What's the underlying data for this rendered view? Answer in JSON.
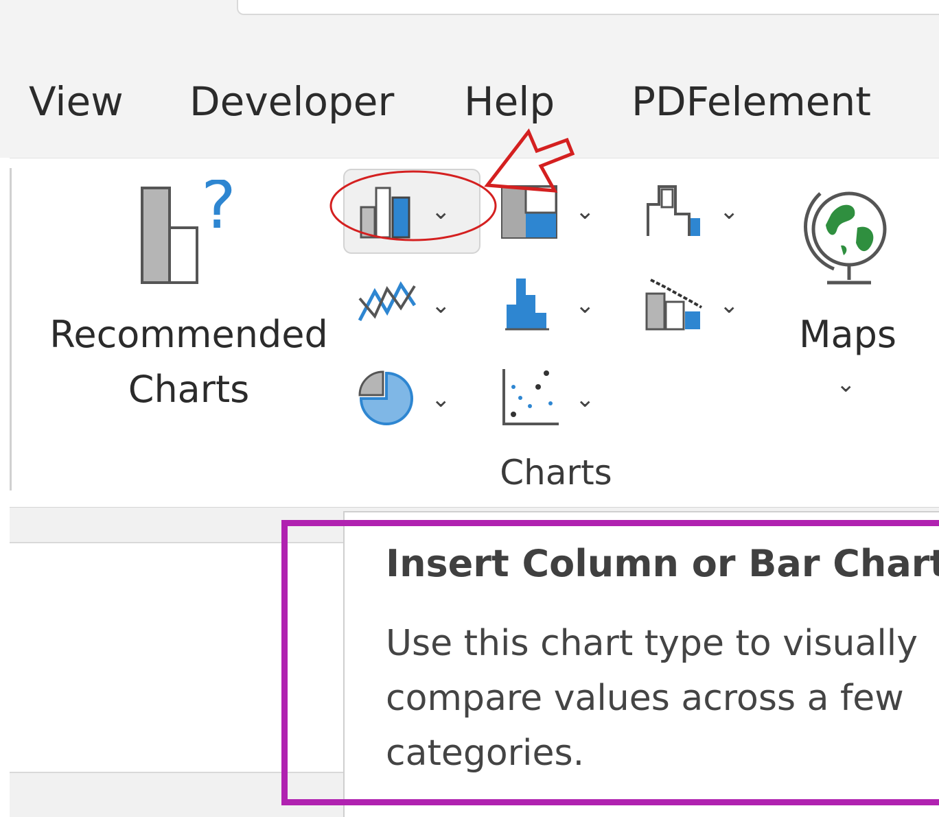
{
  "tabs": [
    {
      "label": "View"
    },
    {
      "label": "Developer"
    },
    {
      "label": "Help"
    },
    {
      "label": "PDFelement"
    }
  ],
  "ribbon": {
    "recommended_charts": {
      "line1": "Recommended",
      "line2": "Charts"
    },
    "maps": {
      "label": "Maps"
    },
    "group_label": "Charts",
    "icons": {
      "column_bar": "column-bar-chart-icon",
      "hierarchy": "hierarchy-chart-icon",
      "waterfall": "waterfall-chart-icon",
      "line": "line-chart-icon",
      "statistic": "statistic-chart-icon",
      "combo": "combo-chart-icon",
      "pie": "pie-chart-icon",
      "scatter": "scatter-chart-icon",
      "globe": "globe-icon"
    }
  },
  "tooltip": {
    "title": "Insert Column or Bar Chart",
    "body": "Use this chart type to visually compare values across a few categories."
  },
  "colors": {
    "accent_blue": "#2e86d1",
    "highlight_purple": "#b022b0",
    "annotation_red": "#d42020"
  }
}
